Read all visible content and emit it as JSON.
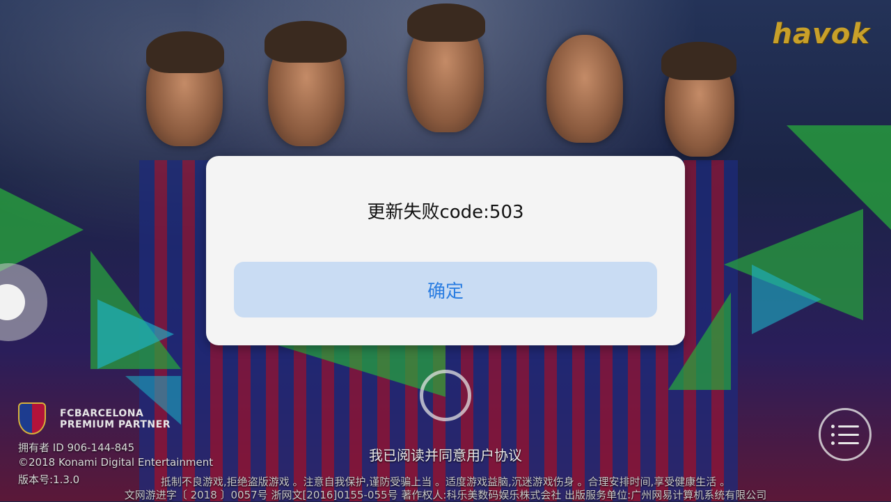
{
  "logo": {
    "text": "havok"
  },
  "dialog": {
    "message": "更新失败code:503",
    "confirm_label": "确定"
  },
  "agreement_text": "我已阅读并同意用户协议",
  "partner": {
    "line1": "FCBARCELONA",
    "line2": "PREMIUM PARTNER"
  },
  "footer": {
    "owner_id": "拥有者 ID 906-144-845",
    "copyright": "©2018 Konami Digital Entertainment",
    "version": "版本号:1.3.0",
    "notice_line1": "抵制不良游戏,拒绝盗版游戏 。注意自我保护,谨防受骗上当 。适度游戏益脑,沉迷游戏伤身 。合理安排时间,享受健康生活 。",
    "notice_line2": "文网游进字〔 2018 〕0057号 浙网文[2016]0155-055号 著作权人:科乐美数码娱乐株式会社 出版服务单位:广州网易计算机系统有限公司"
  },
  "icons": {
    "menu": "menu-list-icon",
    "joystick": "virtual-joystick",
    "loading": "loading-ring-icon",
    "crest": "fc-barcelona-crest-icon"
  },
  "colors": {
    "dialog_bg": "#f4f4f4",
    "confirm_bg": "#c9dcf3",
    "confirm_text": "#2a7de1",
    "logo_gold": "#c8a02a"
  }
}
